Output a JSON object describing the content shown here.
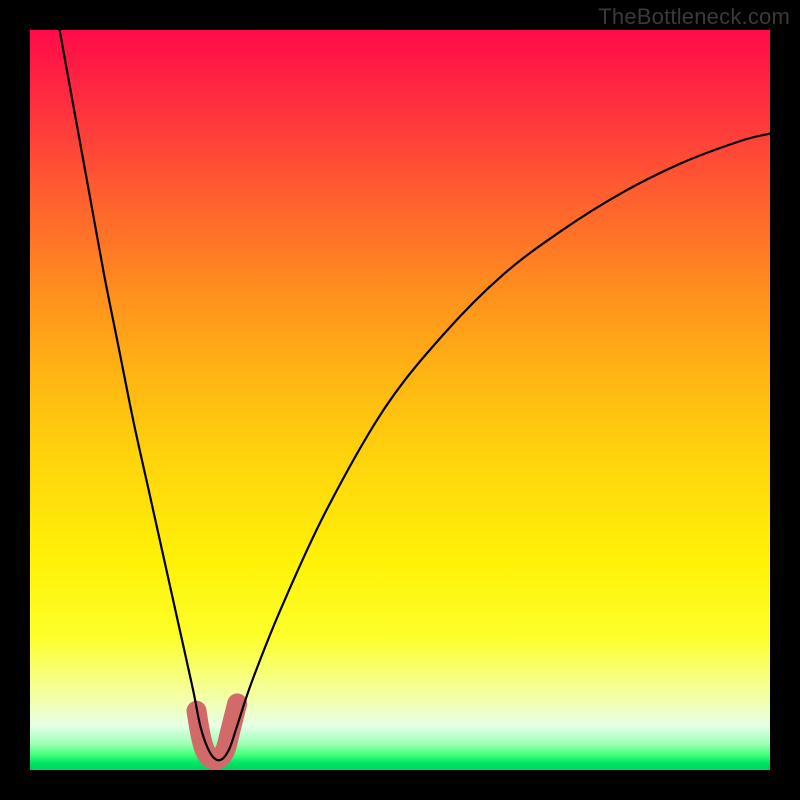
{
  "watermark": "TheBottleneck.com",
  "chart_data": {
    "type": "line",
    "title": "",
    "xlabel": "",
    "ylabel": "",
    "xlim": [
      0,
      100
    ],
    "ylim": [
      0,
      100
    ],
    "series": [
      {
        "name": "bottleneck-curve",
        "x": [
          4,
          6,
          8,
          10,
          12,
          14,
          16,
          18,
          20,
          22,
          23,
          24,
          25,
          26,
          27,
          28,
          30,
          34,
          40,
          48,
          56,
          64,
          72,
          80,
          88,
          96,
          100
        ],
        "values": [
          100,
          89,
          78,
          67,
          57,
          47,
          38,
          29,
          20,
          11,
          6,
          3,
          1.5,
          1.5,
          3,
          6,
          12,
          22,
          35,
          49,
          59,
          67,
          73,
          78,
          82,
          85,
          86
        ]
      }
    ],
    "highlight": {
      "name": "minimum-band",
      "x": [
        22.5,
        23,
        23.5,
        24,
        24.5,
        25,
        25.5,
        26,
        26.5,
        27,
        27.5,
        28
      ],
      "values": [
        8,
        5,
        3,
        2,
        1.5,
        1.5,
        1.5,
        2,
        3,
        5,
        7,
        9
      ]
    },
    "background_gradient": {
      "top": "#ff0b49",
      "mid": "#ffd40c",
      "bottom": "#00d05c"
    }
  }
}
